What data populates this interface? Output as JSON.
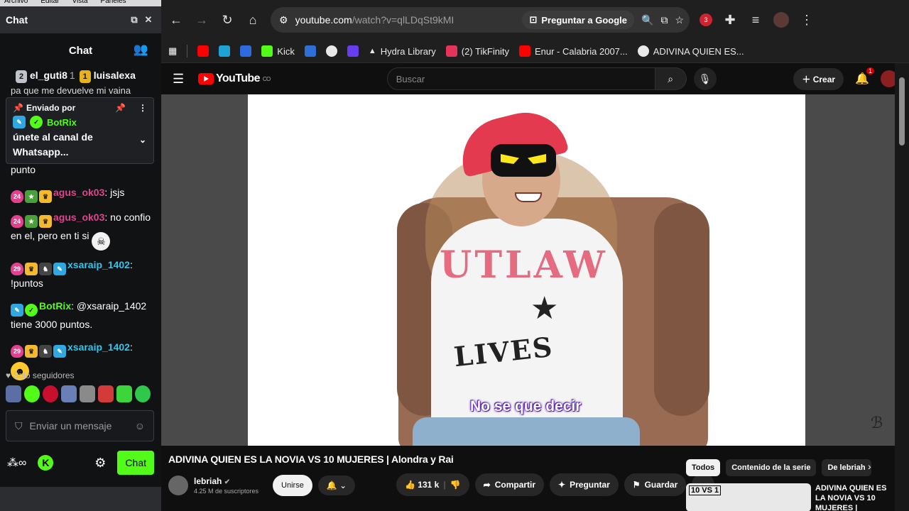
{
  "os_menu": [
    "Archivo",
    "Editar",
    "Vista",
    "Paneles"
  ],
  "chat": {
    "window_title": "Chat",
    "header_title": "Chat",
    "gifters": [
      {
        "badge": "2",
        "name": "el_guti8",
        "count": "1"
      },
      {
        "badge": "1",
        "name": "luisalexa",
        "count": ""
      }
    ],
    "pinned": {
      "label": "Enviado por",
      "user": "BotRix",
      "message": "únete al canal de Whatsapp..."
    },
    "clipped_top": "pa que me devuelve mi vaina",
    "messages": [
      {
        "badges": [],
        "user": "",
        "user_color": "",
        "text": "punto"
      },
      {
        "badges": [
          "24",
          "og",
          "vip"
        ],
        "user": "agus_ok03",
        "user_color": "pink",
        "text": ": jsjs"
      },
      {
        "badges": [
          "24",
          "og",
          "vip"
        ],
        "user": "agus_ok03",
        "user_color": "pink",
        "text": ": no confio en el, pero en ti si"
      },
      {
        "badges": [
          "29",
          "vip",
          "gray",
          "mod"
        ],
        "user": "xsaraip_1402",
        "user_color": "blue",
        "text": ": !puntos"
      },
      {
        "badges": [
          "mod",
          "ver"
        ],
        "user": "BotRix",
        "user_color": "green",
        "text": ": @xsaraip_1402 tiene 3000 puntos."
      },
      {
        "badges": [
          "29",
          "vip",
          "gray",
          "mod"
        ],
        "user": "xsaraip_1402",
        "user_color": "blue",
        "text": ":"
      }
    ],
    "followers_only": "Solo seguidores",
    "input_placeholder": "Enviar un mensaje",
    "send_button": "Chat"
  },
  "browser": {
    "url_host": "youtube.com",
    "url_path": "/watch?v=qlLDqSt9kMI",
    "ask_google": "Preguntar a Google",
    "ext_badge": "3",
    "bookmarks": [
      {
        "label": "",
        "color": "#ff0000"
      },
      {
        "label": "",
        "color": "#1fa3d6"
      },
      {
        "label": "",
        "color": "#2d6be0"
      },
      {
        "label": "Kick",
        "color": "#53fc18"
      },
      {
        "label": "",
        "color": "#2f6fd8"
      },
      {
        "label": "",
        "color": "#e8e8e8"
      },
      {
        "label": "",
        "color": "#6a3cf0"
      },
      {
        "label": "Hydra Library",
        "color": "#111111"
      },
      {
        "label": "(2) TikFinity",
        "color": "#e6335a"
      },
      {
        "label": "Enur - Calabria 2007...",
        "color": "#ff0000"
      },
      {
        "label": "ADIVINA QUIEN ES...",
        "color": "#e8e8e8"
      }
    ]
  },
  "youtube": {
    "logo_text": "YouTube",
    "logo_region": "CO",
    "search_placeholder": "Buscar",
    "create_label": "Crear",
    "notif_count": "1",
    "subtitle": "No se que decir",
    "video": {
      "title": "ADIVINA QUIEN ES LA NOVIA VS 10 MUJERES | Alondra y Rai",
      "channel": "lebriah",
      "subscribers": "4.25 M de suscriptores",
      "join_label": "Unirse",
      "likes": "131 k",
      "share_label": "Compartir",
      "ask_label": "Preguntar",
      "save_label": "Guardar"
    },
    "chips": [
      "Todos",
      "Contenido de la serie",
      "De lebriah"
    ],
    "rec": {
      "thumb_label": "10 VS 1",
      "title": "ADIVINA QUIEN ES LA NOVIA VS 10 MUJERES |"
    }
  }
}
